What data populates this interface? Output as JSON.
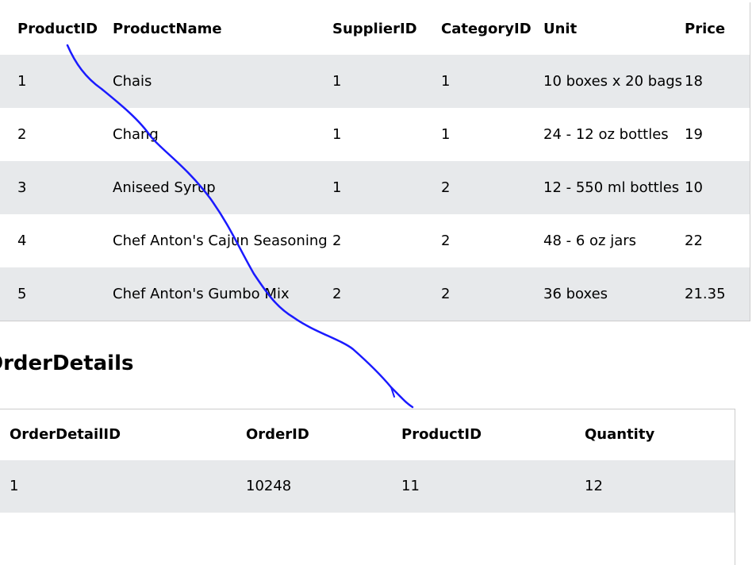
{
  "products": {
    "headers": [
      "ProductID",
      "ProductName",
      "SupplierID",
      "CategoryID",
      "Unit",
      "Price"
    ],
    "rows": [
      [
        "1",
        "Chais",
        "1",
        "1",
        "10 boxes x 20 bags",
        "18"
      ],
      [
        "2",
        "Chang",
        "1",
        "1",
        "24 - 12 oz bottles",
        "19"
      ],
      [
        "3",
        "Aniseed Syrup",
        "1",
        "2",
        "12 - 550 ml bottles",
        "10"
      ],
      [
        "4",
        "Chef Anton's Cajun Seasoning",
        "2",
        "2",
        "48 - 6 oz jars",
        "22"
      ],
      [
        "5",
        "Chef Anton's Gumbo Mix",
        "2",
        "2",
        "36 boxes",
        "21.35"
      ]
    ]
  },
  "order_details": {
    "title": "OrderDetails",
    "headers": [
      "OrderDetailID",
      "OrderID",
      "ProductID",
      "Quantity"
    ],
    "rows": [
      [
        "1",
        "10248",
        "11",
        "12"
      ]
    ]
  },
  "colors": {
    "stripe": "#e7e9eb",
    "border": "#cccccc",
    "annotation_line": "#1a1aff"
  }
}
